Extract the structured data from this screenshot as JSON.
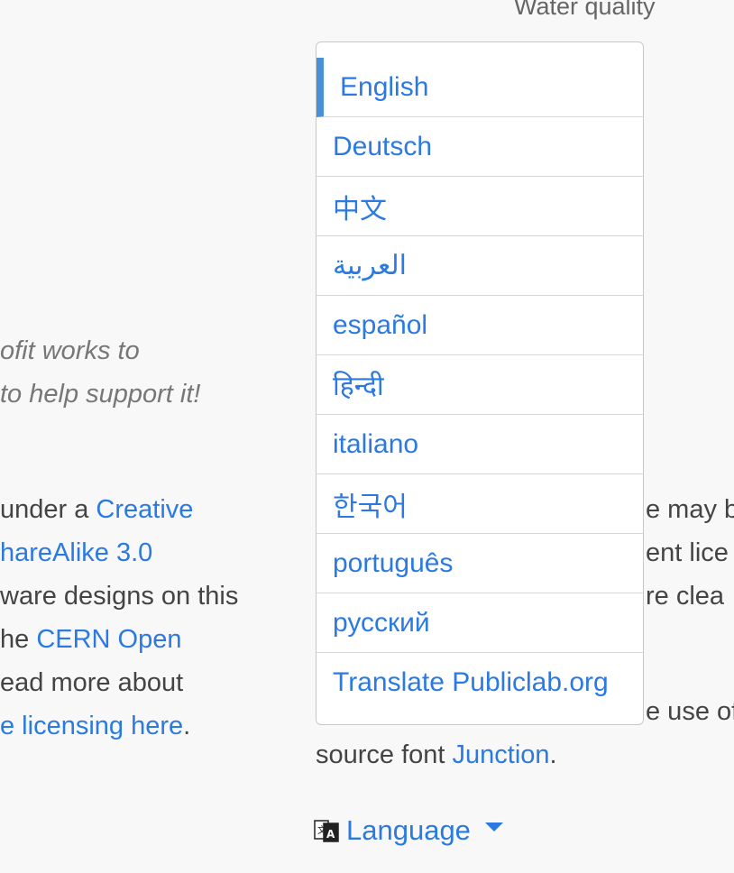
{
  "header": {
    "water_quality": "Water quality"
  },
  "mission": {
    "line1": "ofit works to",
    "line2": " to help support it!"
  },
  "license": {
    "l1_text": "under a ",
    "l1_link": "Creative",
    "l2_link": "hareAlike 3.0",
    "l3_text": "ware designs on this",
    "l4_text": "he ",
    "l4_link": "CERN Open",
    "l5_text": "ead more about",
    "l6_link": "e licensing here",
    "l6_end": "."
  },
  "right_text": {
    "frag1": "e may b",
    "frag2": "ent lice",
    "frag3": "re clea",
    "frag4": "e use of",
    "font_line_text": "source font ",
    "font_link": "Junction",
    "font_end": "."
  },
  "language_menu": {
    "items": [
      "English",
      "Deutsch",
      "中文",
      "العربية",
      "español",
      "हिन्दी",
      "italiano",
      "한국어",
      "português",
      "русский",
      "Translate Publiclab.org"
    ],
    "active_index": 0
  },
  "language_toggle": {
    "label": "Language",
    "icon": "translate-icon"
  },
  "colors": {
    "link": "#2a7ae2",
    "active_bar": "#4a90d9"
  }
}
